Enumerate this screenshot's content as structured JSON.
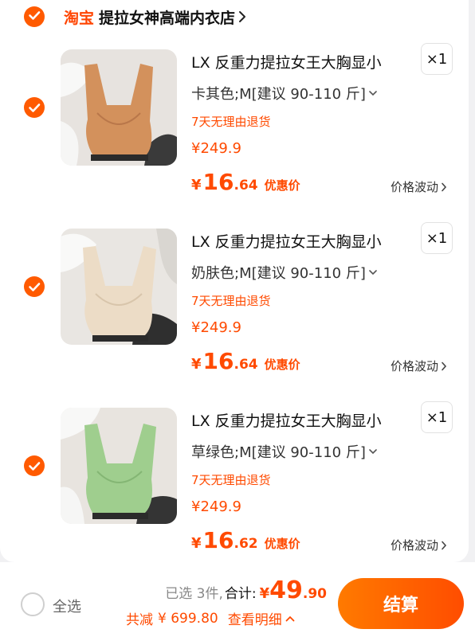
{
  "shop": {
    "brand": "淘宝",
    "name": "提拉女神高端内衣店",
    "accent": "#ff5000"
  },
  "items": [
    {
      "title": "LX 反重力提拉女王大胸显小",
      "quantity": "×1",
      "spec": "卡其色;M[建议 90-110 斤]",
      "return_policy": "7天无理由退货",
      "original_price": "¥249.9",
      "deal_currency": "¥",
      "deal_int": "16",
      "deal_dec": ".64",
      "deal_tag": "优惠价",
      "fluctuation": "价格波动",
      "color": "#d3915c"
    },
    {
      "title": "LX 反重力提拉女王大胸显小",
      "quantity": "×1",
      "spec": "奶肤色;M[建议 90-110 斤]",
      "return_policy": "7天无理由退货",
      "original_price": "¥249.9",
      "deal_currency": "¥",
      "deal_int": "16",
      "deal_dec": ".64",
      "deal_tag": "优惠价",
      "fluctuation": "价格波动",
      "color": "#ecdcc6"
    },
    {
      "title": "LX 反重力提拉女王大胸显小",
      "quantity": "×1",
      "spec": "草绿色;M[建议 90-110 斤]",
      "return_policy": "7天无理由退货",
      "original_price": "¥249.9",
      "deal_currency": "¥",
      "deal_int": "16",
      "deal_dec": ".62",
      "deal_tag": "优惠价",
      "fluctuation": "价格波动",
      "color": "#9fce8e"
    }
  ],
  "footer": {
    "select_all": "全选",
    "selected_count": "已选 3件,",
    "total_label": "合计:",
    "total_currency": "¥",
    "total_int": "49",
    "total_dec": ".90",
    "savings_label": "共减",
    "savings_amount": "¥ 699.80",
    "details": "查看明细",
    "checkout": "结算"
  }
}
